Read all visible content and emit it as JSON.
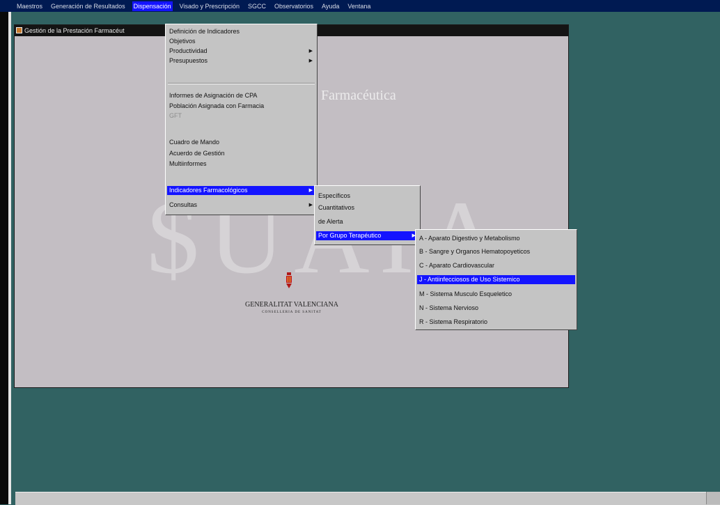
{
  "menubar": {
    "items": [
      {
        "label": "Maestros",
        "active": false
      },
      {
        "label": "Generación de Resultados",
        "active": false
      },
      {
        "label": "Dispensación",
        "active": true
      },
      {
        "label": "Visado y Prescripción",
        "active": false
      },
      {
        "label": "SGCC",
        "active": false
      },
      {
        "label": "Observatorios",
        "active": false
      },
      {
        "label": "Ayuda",
        "active": false
      },
      {
        "label": "Ventana",
        "active": false
      }
    ]
  },
  "window": {
    "title": "Gestión de la Prestación Farmacéut",
    "splash_subtitle": "Farmacéutica",
    "watermark": "$UAIA",
    "logo_text": "GENERALITAT VALENCIANA",
    "logo_subtext": "CONSELLERIA DE SANITAT"
  },
  "menu_dispensacion": {
    "items": [
      {
        "label": "Definición de Indicadores"
      },
      {
        "label": "Objetivos"
      },
      {
        "label": "Productividad",
        "arrow": "▶"
      },
      {
        "label": "Presupuestos",
        "arrow": "▶"
      },
      {
        "label": "Informes de Asignación de CPA"
      },
      {
        "label": "Población Asignada con Farmacia"
      },
      {
        "label": "GFT"
      },
      {
        "label": "Cuadro de Mando"
      },
      {
        "label": "Acuerdo de Gestión"
      },
      {
        "label": "Multiinformes"
      },
      {
        "label": "Indicadores Farmacológicos",
        "arrow": "▶"
      },
      {
        "label": "Consultas",
        "arrow": "▶"
      }
    ]
  },
  "menu_indicadores": {
    "items": [
      {
        "label": "Específicos"
      },
      {
        "label": "Cuantitativos"
      },
      {
        "label": "de Alerta"
      },
      {
        "label": "Por Grupo Terapéutico",
        "arrow": "▶"
      }
    ]
  },
  "menu_grupo": {
    "items": [
      {
        "label": "A - Aparato Digestivo y Metabolismo"
      },
      {
        "label": "B - Sangre y Organos Hematopoyeticos"
      },
      {
        "label": "C - Aparato Cardiovascular"
      },
      {
        "label": "J - Antiinfecciosos de Uso Sistemico"
      },
      {
        "label": "M - Sistema Musculo Esqueletico"
      },
      {
        "label": "N - Sistema Nervioso"
      },
      {
        "label": "R - Sistema Respiratorio"
      }
    ]
  },
  "colors": {
    "desktop": "#316262",
    "highlight": "#1414ff",
    "menubar": "#001a52"
  }
}
